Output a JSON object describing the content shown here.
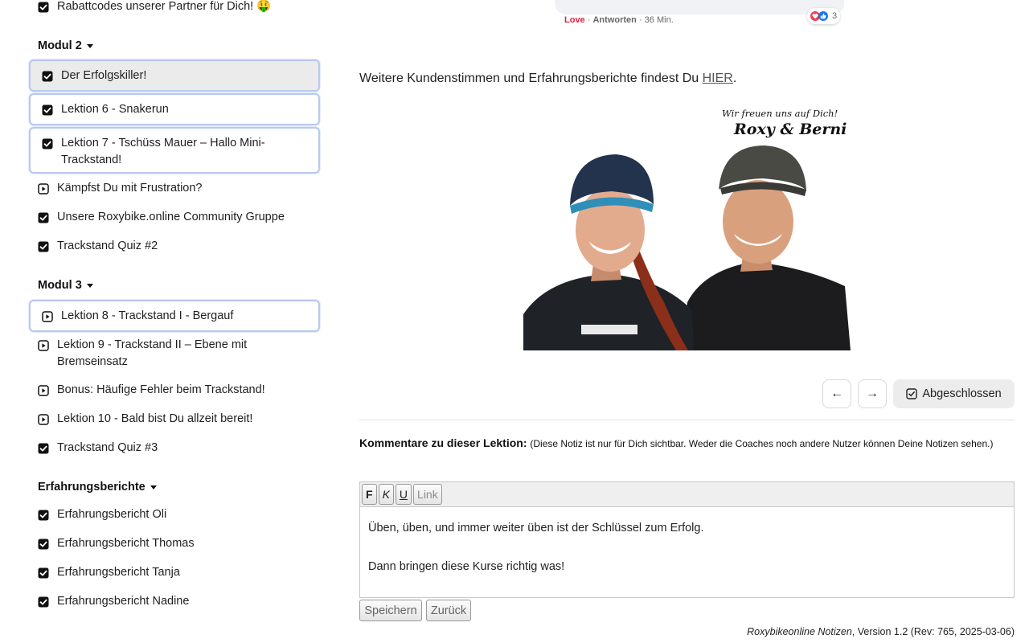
{
  "sidebar": {
    "top_item": {
      "label": "Rabattcodes unserer Partner für Dich! 🤑",
      "status": "done"
    },
    "modules": [
      {
        "title": "Modul 2",
        "items": [
          {
            "label": "Der Erfolgskiller!",
            "status": "done"
          },
          {
            "label": "Lektion 6 - Snakerun",
            "status": "done"
          },
          {
            "label": "Lektion 7 - Tschüss Mauer – Hallo Mini-Trackstand!",
            "status": "done"
          },
          {
            "label": "Kämpfst Du mit Frustration?",
            "status": "play"
          },
          {
            "label": "Unsere Roxybike.online Community Gruppe",
            "status": "done"
          },
          {
            "label": "Trackstand Quiz #2",
            "status": "done"
          }
        ]
      },
      {
        "title": "Modul 3",
        "items": [
          {
            "label": "Lektion 8 - Trackstand I - Bergauf",
            "status": "play"
          },
          {
            "label": "Lektion 9 - Trackstand II – Ebene mit Bremseinsatz",
            "status": "play"
          },
          {
            "label": "Bonus: Häufige Fehler beim Trackstand!",
            "status": "play"
          },
          {
            "label": "Lektion 10 - Bald bist Du allzeit bereit!",
            "status": "play"
          },
          {
            "label": "Trackstand Quiz #3",
            "status": "done"
          }
        ]
      },
      {
        "title": "Erfahrungsberichte",
        "items": [
          {
            "label": "Erfahrungsbericht Oli",
            "status": "done"
          },
          {
            "label": "Erfahrungsbericht Thomas",
            "status": "done"
          },
          {
            "label": "Erfahrungsbericht Tanja",
            "status": "done"
          },
          {
            "label": "Erfahrungsbericht Nadine",
            "status": "done"
          }
        ]
      }
    ]
  },
  "comment": {
    "reaction_count": "3",
    "love": "Love",
    "reply": "Antworten",
    "time": "36 Min."
  },
  "main": {
    "testimonials_text": "Weitere Kundenstimmen und Erfahrungsberichte findest Du",
    "testimonials_link": "HIER",
    "testimonials_end": ".",
    "photo_caption": "Wir freuen uns auf Dich!",
    "photo_signature": "Roxy & Berni",
    "done_label": "Abgeschlossen",
    "prev_symbol": "←",
    "next_symbol": "→"
  },
  "notes": {
    "label": "Kommentare zu dieser Lektion:",
    "hint": "(Diese Notiz ist nur für Dich sichtbar. Weder die Coaches noch andere Nutzer können Deine Notizen sehen.)",
    "toolbar": {
      "bold": "F",
      "italic": "K",
      "underline": "U",
      "link": "Link"
    },
    "line1": "Üben, üben, und immer weiter üben ist der Schlüssel zum Erfolg.",
    "line2": "Dann bringen diese Kurse richtig was!",
    "save": "Speichern",
    "back": "Zurück"
  },
  "footer": {
    "name": "Roxybikeonline Notizen",
    "version": ", Version 1.2 (Rev: 765, 2025-03-06)"
  },
  "colors": {
    "accent_border": "#b7c9f0",
    "love": "#e41e3f",
    "active_bg": "#ebebeb"
  }
}
